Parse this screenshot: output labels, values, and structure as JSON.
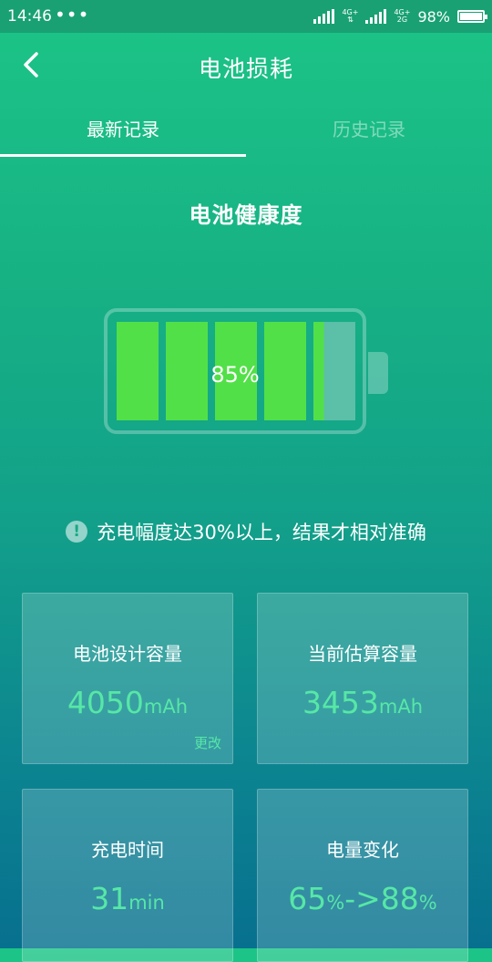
{
  "status_bar": {
    "time": "14:46",
    "dots": "•••",
    "net1_top": "4G+",
    "net2_top": "4G+",
    "net2_bottom": "2G",
    "battery": "98%",
    "battery_level": 0.98
  },
  "header": {
    "title": "电池损耗"
  },
  "tabs": [
    {
      "label": "最新记录",
      "active": true
    },
    {
      "label": "历史记录",
      "active": false
    }
  ],
  "health": {
    "title": "电池健康度",
    "percent_label": "85%",
    "level": 0.85
  },
  "notice": {
    "icon": "!",
    "text": "充电幅度达30%以上，结果才相对准确"
  },
  "cards": [
    {
      "label": "电池设计容量",
      "value": "4050",
      "unit": "mAh",
      "action": "更改"
    },
    {
      "label": "当前估算容量",
      "value": "3453",
      "unit": "mAh"
    },
    {
      "label": "充电时间",
      "value": "31",
      "unit": "min"
    },
    {
      "label": "电量变化",
      "value_from": "65",
      "unit_from": "%",
      "arrow": "->",
      "value_to": "88",
      "unit_to": "%"
    }
  ],
  "colors": {
    "cell_fill": "#52e048",
    "cell_empty": "#5cbfa8",
    "accent": "#57e7a6"
  }
}
